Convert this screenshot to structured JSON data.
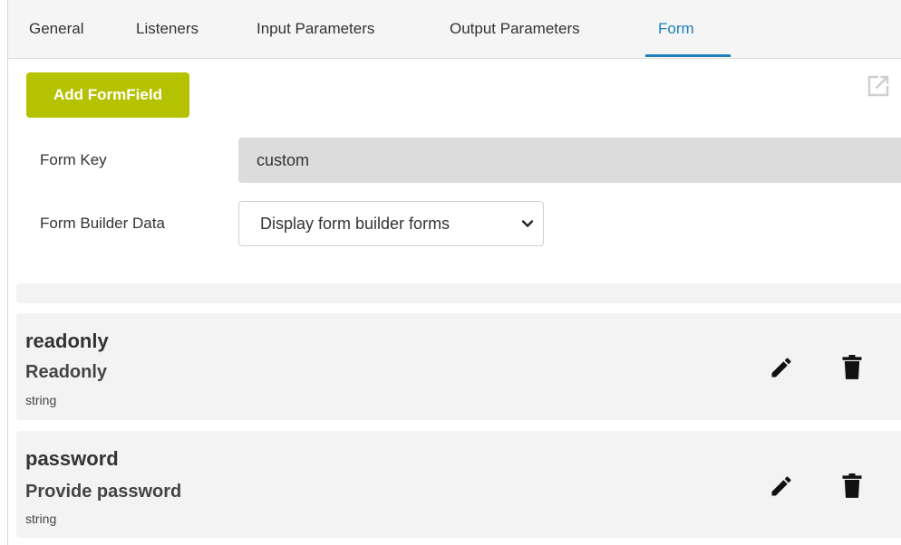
{
  "tabs": [
    {
      "label": "General",
      "active": false
    },
    {
      "label": "Listeners",
      "active": false
    },
    {
      "label": "Input Parameters",
      "active": false
    },
    {
      "label": "Output Parameters",
      "active": false
    },
    {
      "label": "Form",
      "active": true
    }
  ],
  "toolbar": {
    "add_label": "Add FormField",
    "add_color": "#b5c200",
    "popout_icon": "open-in-new-icon"
  },
  "form": {
    "key_label": "Form Key",
    "key_value": "custom",
    "builder_label": "Form Builder Data",
    "builder_selected": "Display form builder forms"
  },
  "fields": [
    {
      "name": "readonly",
      "label": "Readonly",
      "type": "string"
    },
    {
      "name": "password",
      "label": "Provide password",
      "type": "string"
    }
  ],
  "colors": {
    "accent": "#1f7fbf",
    "button": "#b5c200"
  }
}
